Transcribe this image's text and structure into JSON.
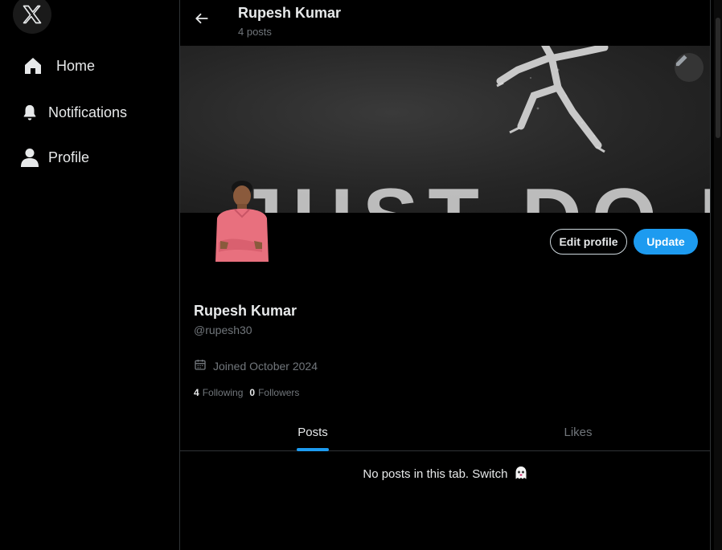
{
  "sidebar": {
    "logo_icon": "x-logo-icon",
    "items": [
      {
        "label": "Home",
        "icon": "home-icon"
      },
      {
        "label": "Notifications",
        "icon": "bell-icon"
      },
      {
        "label": "Profile",
        "icon": "user-icon"
      }
    ]
  },
  "header": {
    "name": "Rupesh Kumar",
    "post_count": "4 posts",
    "back_icon": "arrow-left-icon"
  },
  "banner": {
    "text": "JUST DO IT",
    "edit_icon": "pencil-icon"
  },
  "actions": {
    "edit_label": "Edit profile",
    "update_label": "Update"
  },
  "profile": {
    "name": "Rupesh Kumar",
    "handle": "@rupesh30",
    "joined": "Joined October 2024",
    "following_count": "4",
    "following_label": "Following",
    "followers_count": "0",
    "followers_label": "Followers"
  },
  "tabs": [
    {
      "label": "Posts",
      "active": true
    },
    {
      "label": "Likes",
      "active": false
    }
  ],
  "empty_message": "No posts in this tab. Switch",
  "colors": {
    "accent": "#1d9bf0",
    "background": "#000000",
    "muted": "#71767b",
    "shirt": "#e8707e"
  }
}
